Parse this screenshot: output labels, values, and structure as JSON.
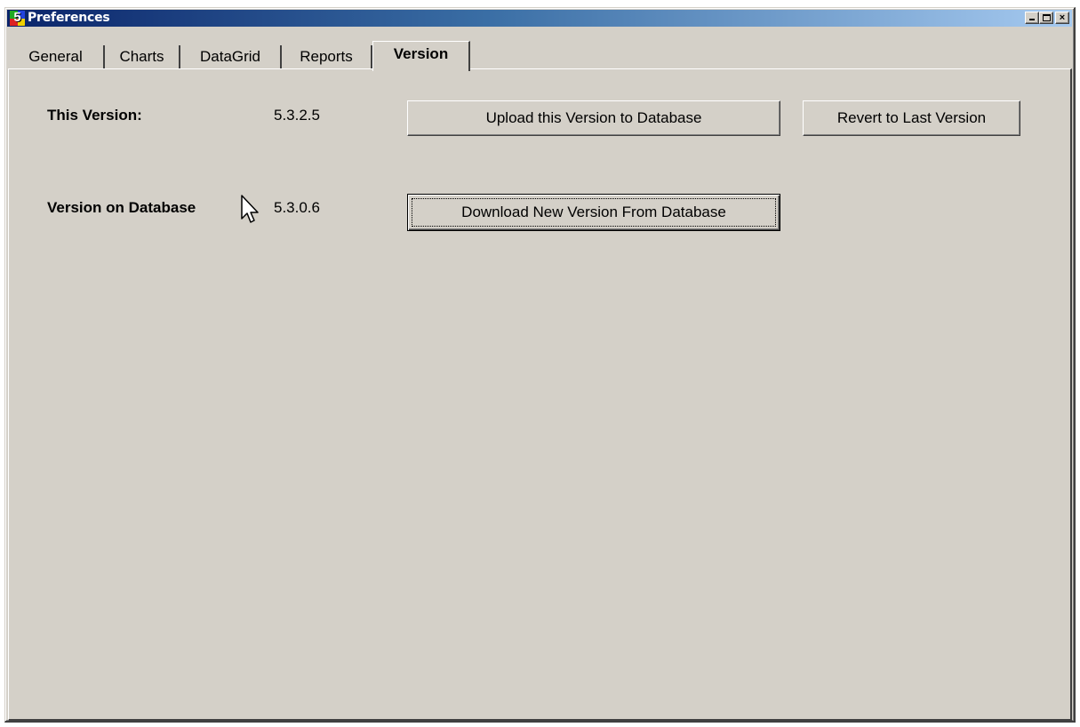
{
  "window": {
    "title": "Preferences",
    "app_icon_glyph": "5",
    "minimize_glyph": "minimize-icon",
    "maximize_glyph": "maximize-icon",
    "close_glyph": "×"
  },
  "tabs": [
    {
      "label": "General",
      "active": false
    },
    {
      "label": "Charts",
      "active": false
    },
    {
      "label": "DataGrid",
      "active": false
    },
    {
      "label": "Reports",
      "active": false
    },
    {
      "label": "Version",
      "active": true
    }
  ],
  "version_panel": {
    "this_version_label": "This Version:",
    "this_version_value": "5.3.2.5",
    "db_version_label": "Version on Database",
    "db_version_value": "5.3.0.6",
    "upload_button": "Upload this Version to Database",
    "revert_button": "Revert to Last Version",
    "download_button": "Download New Version From Database"
  },
  "colors": {
    "face": "#d4d0c8",
    "title_start": "#0a246a",
    "title_end": "#a6caf0"
  }
}
